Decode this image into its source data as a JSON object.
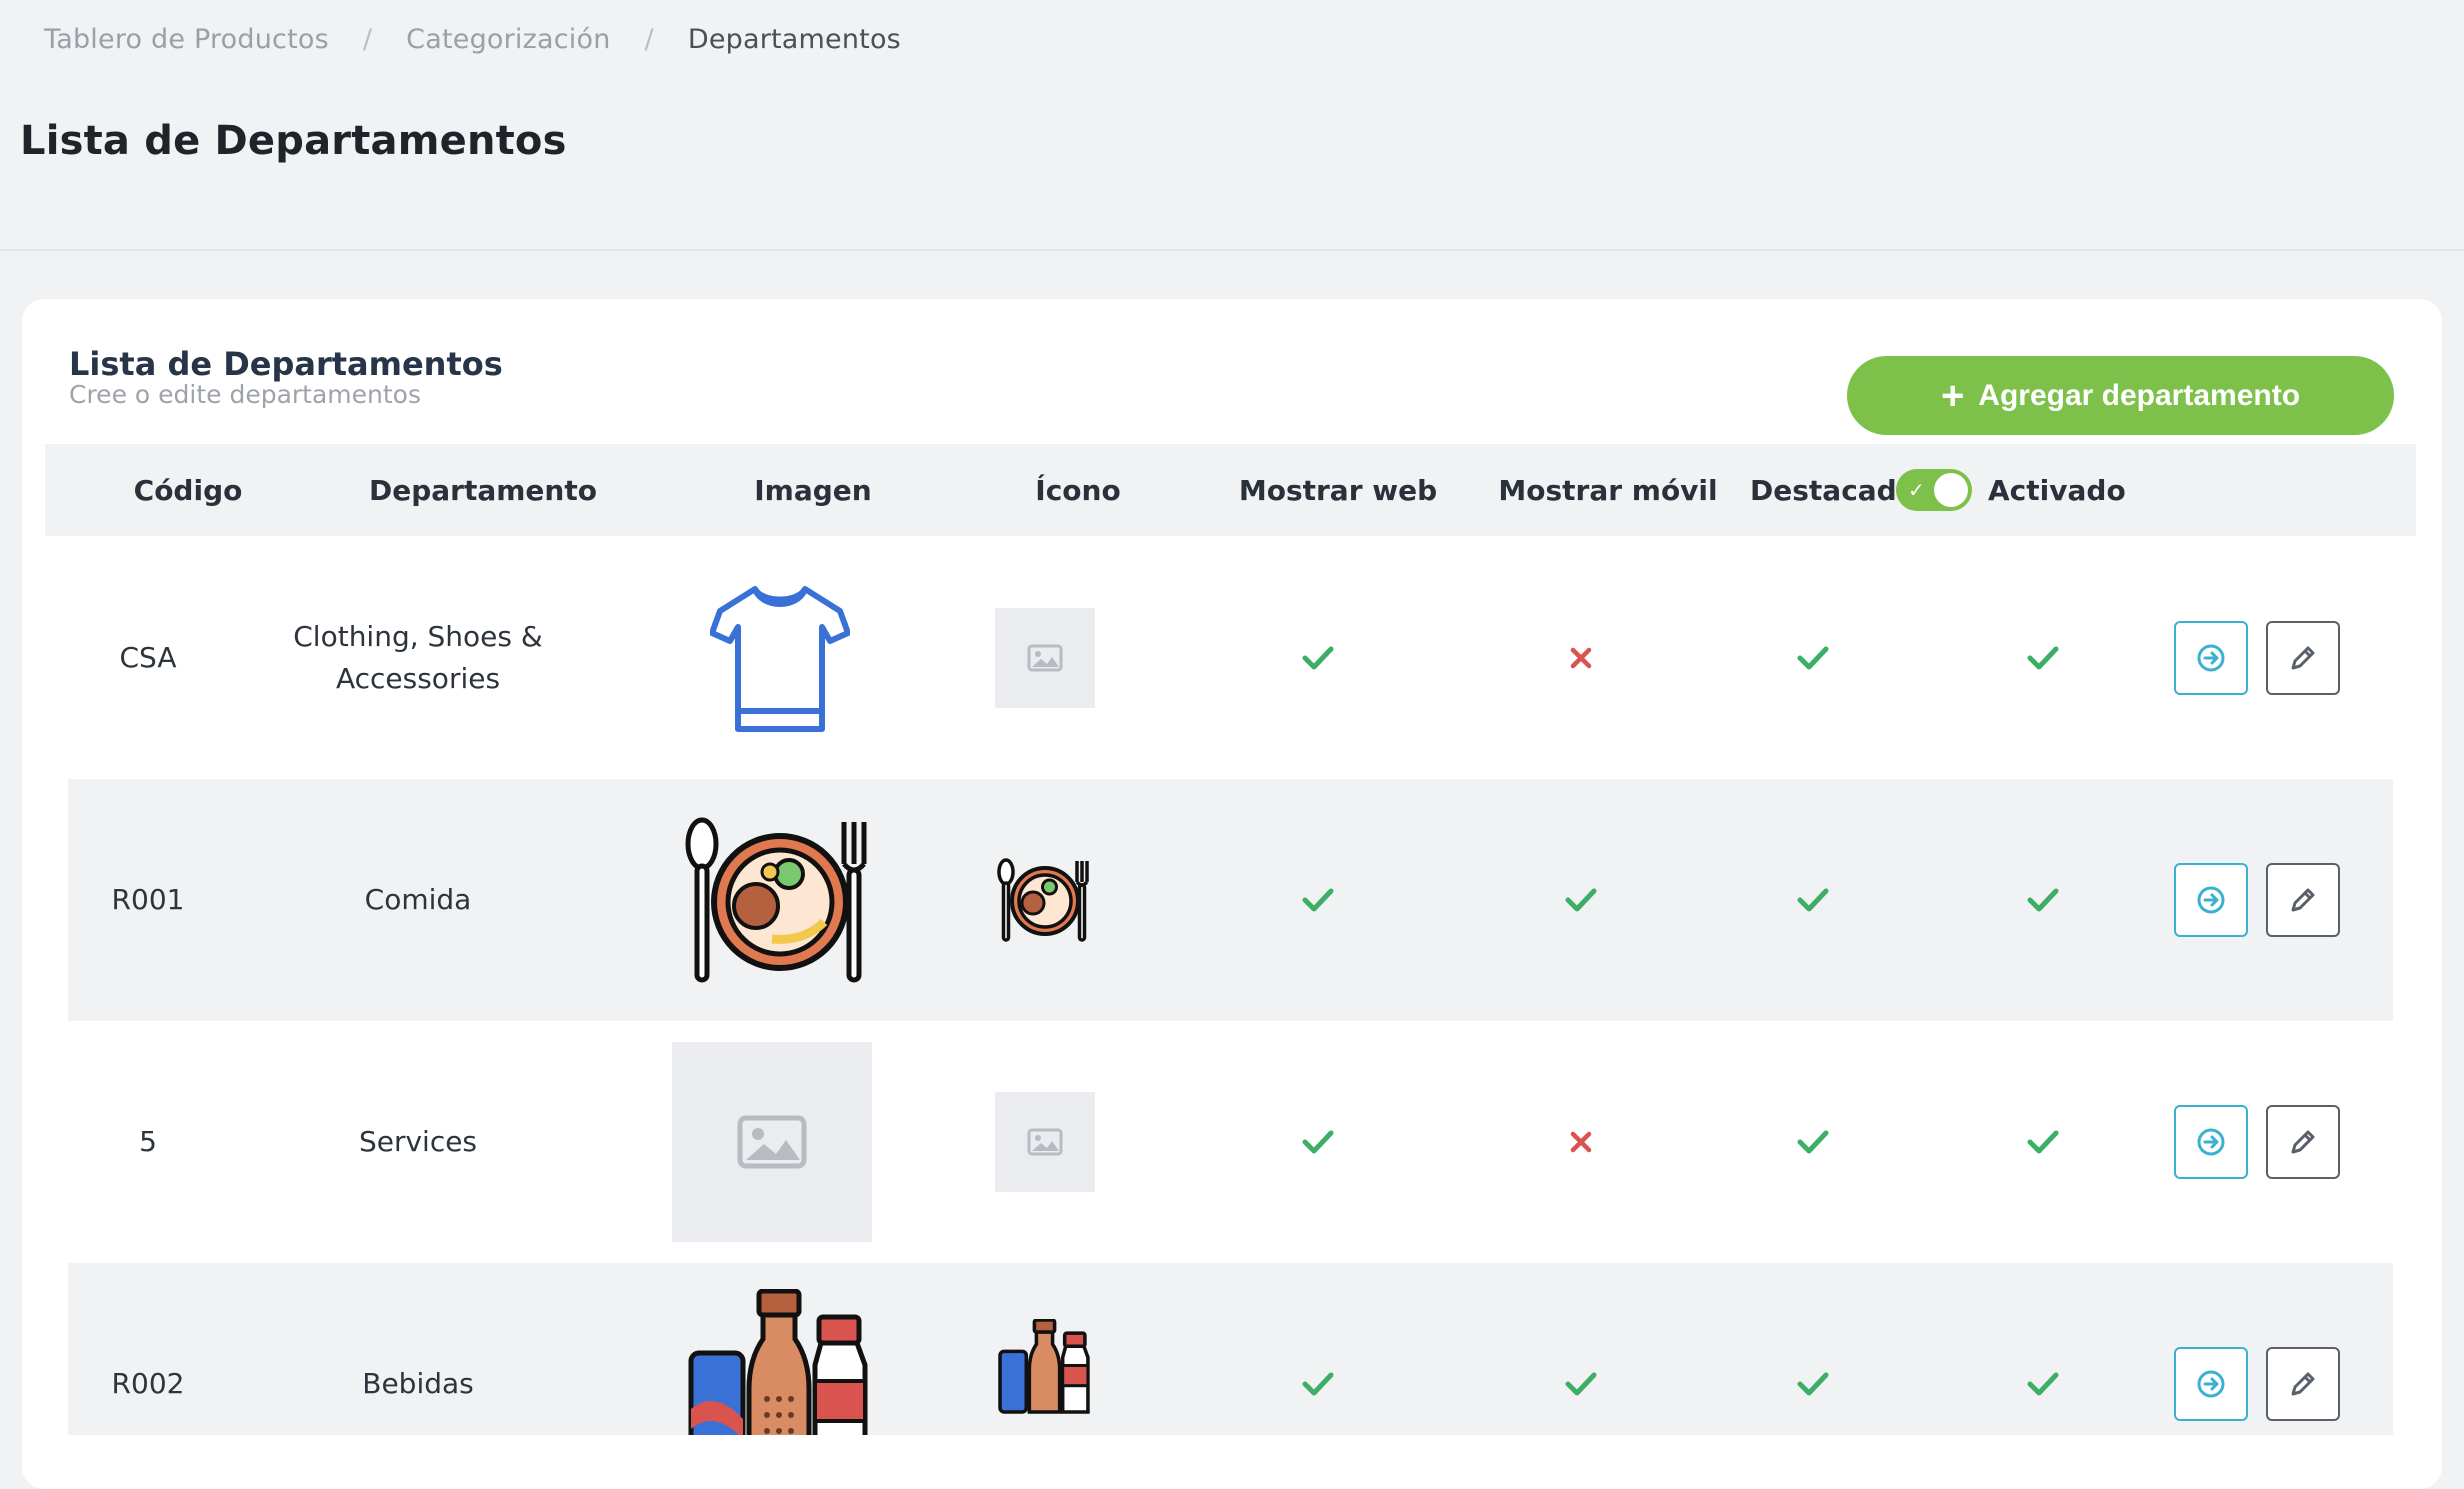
{
  "breadcrumb": {
    "items": [
      "Tablero de Productos",
      "Categorización",
      "Departamentos"
    ],
    "separator": "/"
  },
  "page": {
    "title": "Lista de Departamentos"
  },
  "card": {
    "title": "Lista de Departamentos",
    "subtitle": "Cree o edite departamentos",
    "add_button": "Agregar departamento"
  },
  "table": {
    "columns": {
      "code": "Código",
      "department": "Departamento",
      "image": "Imagen",
      "icon": "Ícono",
      "show_web": "Mostrar web",
      "show_mobile": "Mostrar móvil",
      "featured": "Destacado",
      "activated": "Activado"
    },
    "activated_filter_on": true,
    "rows": [
      {
        "code": "CSA",
        "name": "Clothing, Shoes & Accessories",
        "image": "t-shirt-image",
        "icon": "placeholder-image-icon",
        "show_web": true,
        "show_mobile": false,
        "featured": true,
        "active": true
      },
      {
        "code": "R001",
        "name": "Comida",
        "image": "food-plate-image",
        "icon": "food-plate-icon",
        "show_web": true,
        "show_mobile": true,
        "featured": true,
        "active": true
      },
      {
        "code": "5",
        "name": "Services",
        "image": "placeholder-image",
        "icon": "placeholder-image-icon",
        "show_web": true,
        "show_mobile": false,
        "featured": true,
        "active": true
      },
      {
        "code": "R002",
        "name": "Bebidas",
        "image": "drinks-bottles-image",
        "icon": "drinks-bottles-icon",
        "show_web": true,
        "show_mobile": true,
        "featured": true,
        "active": true
      }
    ]
  },
  "colors": {
    "accent_green": "#7dc04a",
    "check_green": "#3dae66",
    "cross_red": "#d9534f",
    "go_cyan": "#3bb1cf"
  }
}
